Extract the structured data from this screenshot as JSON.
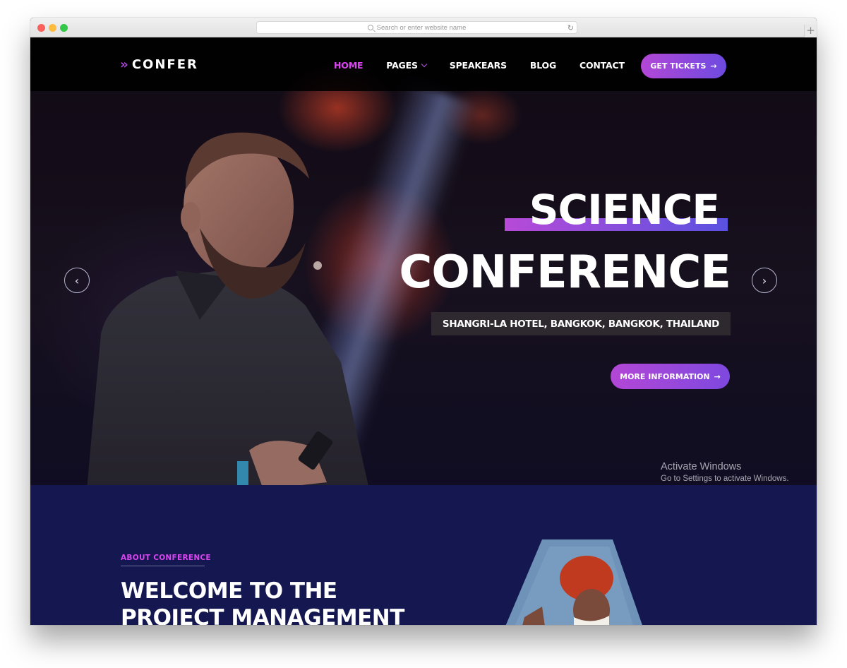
{
  "browser": {
    "address_placeholder": "Search or enter website name",
    "reload_icon": "reload-icon",
    "new_tab_icon": "plus-icon"
  },
  "brand": {
    "name": "CONFER",
    "logo_icon": "double-chevron-icon",
    "accent": "#a84ad6"
  },
  "nav": {
    "items": [
      {
        "label": "HOME",
        "active": true
      },
      {
        "label": "PAGES",
        "dropdown": true
      },
      {
        "label": "SPEAKEARS"
      },
      {
        "label": "BLOG"
      },
      {
        "label": "CONTACT"
      }
    ],
    "cta": "GET TICKETS"
  },
  "hero": {
    "title_line1": "SCIENCE",
    "title_line2": "CONFERENCE",
    "location": "SHANGRI-LA HOTEL, BANGKOK, BANGKOK, THAILAND",
    "button": "MORE INFORMATION"
  },
  "watermark": {
    "line1": "Activate Windows",
    "line2": "Go to Settings to activate Windows."
  },
  "about": {
    "tag": "ABOUT CONFERENCE",
    "title_line1": "WELCOME TO THE",
    "title_line2": "PROJECT MANAGEMENT"
  },
  "colors": {
    "accent_pink": "#d946ef",
    "gradient_start": "#b347d6",
    "gradient_end": "#6d4ae0",
    "about_bg": "#151750"
  }
}
